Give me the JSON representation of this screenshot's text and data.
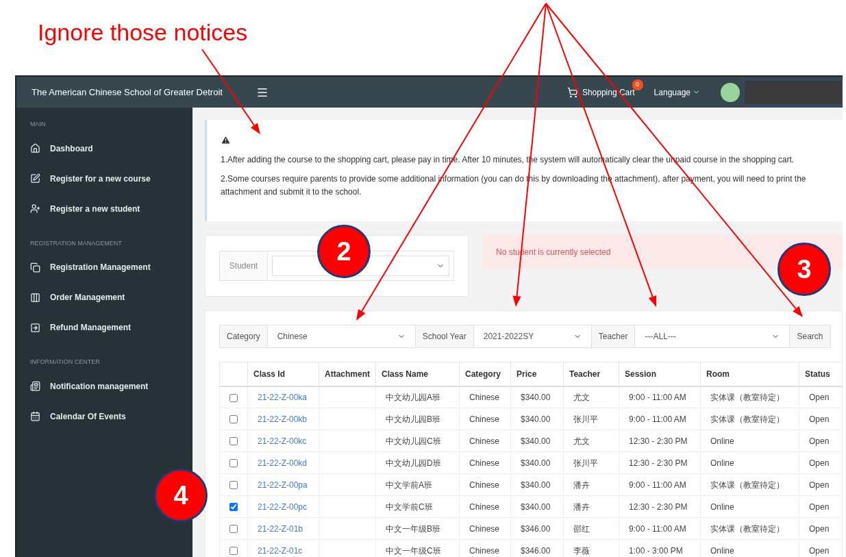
{
  "annotations": {
    "note": "Ignore those notices",
    "markers": [
      "2",
      "3",
      "4"
    ]
  },
  "header": {
    "title": "The American Chinese School of Greater Detroit",
    "cart": "Shopping Cart",
    "cart_badge": "0",
    "language": "Language"
  },
  "sidebar": [
    {
      "heading": "MAIN",
      "items": [
        "Dashboard",
        "Register for a new course",
        "Register a new student"
      ]
    },
    {
      "heading": "REGISTRATION MANAGEMENT",
      "items": [
        "Registration Management",
        "Order Management",
        "Refund Management"
      ]
    },
    {
      "heading": "INFORMATION CENTER",
      "items": [
        "Notification management",
        "Calendar Of Events"
      ]
    }
  ],
  "notice": {
    "lines": [
      "1.After adding the course to the shopping cart, please pay in time. After 10 minutes, the system will automatically clear the unpaid course in the shopping cart.",
      "2.Some courses require parents to provide some additional information (you can do this by downloading the attachment), after payment, you will need to print the attachment and submit it to the school."
    ]
  },
  "student": {
    "label": "Student"
  },
  "alert": "No student is currently selected",
  "filters": [
    {
      "label": "Category",
      "value": "Chinese"
    },
    {
      "label": "School Year",
      "value": "2021-2022SY"
    },
    {
      "label": "Teacher",
      "value": "---ALL---"
    }
  ],
  "search_button": "Search",
  "table": {
    "columns": [
      "Class Id",
      "Attachment",
      "Class Name",
      "Category",
      "Price",
      "Teacher",
      "Session",
      "Room",
      "Status"
    ],
    "rows": [
      {
        "checked": false,
        "cells": [
          "21-22-Z-00ka",
          "",
          "中文幼儿园A班",
          "Chinese",
          "$340.00",
          "尤文",
          "9:00 - 11:00 AM",
          "实体课（教室待定）",
          "Open"
        ]
      },
      {
        "checked": false,
        "cells": [
          "21-22-Z-00kb",
          "",
          "中文幼儿园B班",
          "Chinese",
          "$340.00",
          "张川平",
          "9:00 - 11:00 AM",
          "实体课（教室待定）",
          "Open"
        ]
      },
      {
        "checked": false,
        "cells": [
          "21-22-Z-00kc",
          "",
          "中文幼儿园C班",
          "Chinese",
          "$340.00",
          "尤文",
          "12:30 - 2:30 PM",
          "Online",
          "Open"
        ]
      },
      {
        "checked": false,
        "cells": [
          "21-22-Z-00kd",
          "",
          "中文幼儿园D班",
          "Chinese",
          "$340.00",
          "张川平",
          "12:30 - 2:30 PM",
          "Online",
          "Open"
        ]
      },
      {
        "checked": false,
        "cells": [
          "21-22-Z-00pa",
          "",
          "中文学前A班",
          "Chinese",
          "$340.00",
          "潘卉",
          "9:00 - 11:00 AM",
          "实体课（教室待定）",
          "Open"
        ]
      },
      {
        "checked": true,
        "cells": [
          "21-22-Z-00pc",
          "",
          "中文学前C班",
          "Chinese",
          "$340.00",
          "潘卉",
          "12:30 - 2:30 PM",
          "Online",
          "Open"
        ]
      },
      {
        "checked": false,
        "cells": [
          "21-22-Z-01b",
          "",
          "中文一年级B班",
          "Chinese",
          "$346.00",
          "邵红",
          "9:00 - 11:00 AM",
          "实体课（教室待定）",
          "Open"
        ]
      },
      {
        "checked": false,
        "cells": [
          "21-22-Z-01c",
          "",
          "中文一年级C班",
          "Chinese",
          "$346.00",
          "李薇",
          "1:00 - 3:00 PM",
          "Online",
          "Open"
        ]
      }
    ]
  }
}
